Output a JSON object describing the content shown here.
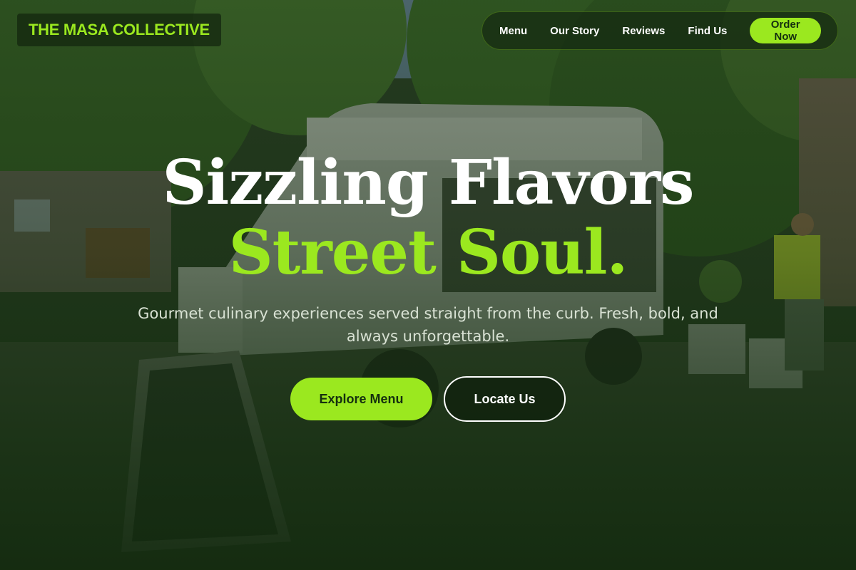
{
  "brand": {
    "name": "THE MASA COLLECTIVE"
  },
  "nav": {
    "links": [
      "Menu",
      "Our Story",
      "Reviews",
      "Find Us"
    ],
    "cta": "Order Now"
  },
  "hero": {
    "title_line1": "Sizzling Flavors",
    "title_line2": "Street Soul.",
    "subtitle": "Gourmet culinary experiences served straight from the curb. Fresh, bold, and always unforgettable.",
    "primary_button": "Explore Menu",
    "secondary_button": "Locate Us"
  },
  "colors": {
    "accent": "#9be81f",
    "overlay": "#1c2d19",
    "text": "#ffffff"
  }
}
